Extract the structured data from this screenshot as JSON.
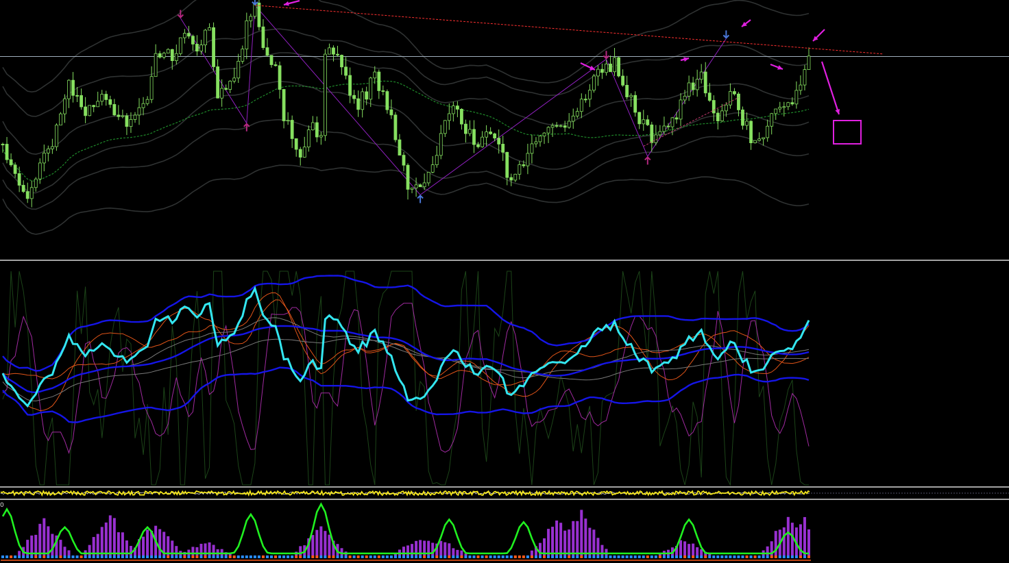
{
  "window": {
    "background": "#000000",
    "separator_color": "#d9d9d9"
  },
  "chart_data": [
    {
      "type": "candlestick",
      "panel": "price",
      "title": "",
      "grid": false,
      "bar_count": 196,
      "axes": {
        "x_ticks": [],
        "y_ticks": []
      },
      "close_path": [
        [
          0,
          0.55
        ],
        [
          6,
          0.78
        ],
        [
          8,
          0.68
        ],
        [
          13,
          0.5
        ],
        [
          16,
          0.3
        ],
        [
          20,
          0.45
        ],
        [
          24,
          0.35
        ],
        [
          30,
          0.48
        ],
        [
          35,
          0.4
        ],
        [
          37,
          0.17
        ],
        [
          41,
          0.22
        ],
        [
          44,
          0.1
        ],
        [
          47,
          0.18
        ],
        [
          50,
          0.1
        ],
        [
          52,
          0.35
        ],
        [
          57,
          0.25
        ],
        [
          59,
          0.1
        ],
        [
          61,
          0.02
        ],
        [
          63,
          0.18
        ],
        [
          66,
          0.25
        ],
        [
          68,
          0.45
        ],
        [
          72,
          0.6
        ],
        [
          75,
          0.48
        ],
        [
          77,
          0.52
        ],
        [
          78,
          0.22
        ],
        [
          80,
          0.18
        ],
        [
          83,
          0.3
        ],
        [
          86,
          0.4
        ],
        [
          88,
          0.35
        ],
        [
          90,
          0.28
        ],
        [
          92,
          0.35
        ],
        [
          94,
          0.45
        ],
        [
          96,
          0.6
        ],
        [
          99,
          0.75
        ],
        [
          101,
          0.72
        ],
        [
          104,
          0.65
        ],
        [
          107,
          0.45
        ],
        [
          110,
          0.42
        ],
        [
          112,
          0.5
        ],
        [
          115,
          0.55
        ],
        [
          117,
          0.48
        ],
        [
          120,
          0.55
        ],
        [
          123,
          0.72
        ],
        [
          125,
          0.65
        ],
        [
          128,
          0.55
        ],
        [
          131,
          0.5
        ],
        [
          134,
          0.5
        ],
        [
          137,
          0.44
        ],
        [
          140,
          0.38
        ],
        [
          143,
          0.3
        ],
        [
          146,
          0.26
        ],
        [
          148,
          0.22
        ],
        [
          151,
          0.35
        ],
        [
          154,
          0.45
        ],
        [
          157,
          0.52
        ],
        [
          160,
          0.48
        ],
        [
          163,
          0.45
        ],
        [
          165,
          0.35
        ],
        [
          167,
          0.32
        ],
        [
          169,
          0.3
        ],
        [
          172,
          0.45
        ],
        [
          175,
          0.4
        ],
        [
          177,
          0.35
        ],
        [
          179,
          0.45
        ],
        [
          181,
          0.52
        ],
        [
          184,
          0.5
        ],
        [
          186,
          0.45
        ],
        [
          189,
          0.38
        ],
        [
          191,
          0.4
        ],
        [
          193,
          0.3
        ],
        [
          195,
          0.2
        ]
      ],
      "moving_average": {
        "style": "dashed",
        "color": "#1f8a2a"
      },
      "envelope_band_count": 6,
      "trendlines": [
        {
          "from": [
            61,
            0.01
          ],
          "to": [
            213,
            0.2
          ],
          "style": "dashed",
          "color": "#ff3030"
        },
        {
          "from": [
            155,
            0.56
          ],
          "to": [
            178,
            0.37
          ],
          "style": "dashed",
          "color": "#c23a6e"
        }
      ],
      "horizontal_level": {
        "value": 0.21,
        "color": "#b8c8d8"
      },
      "zigzag_color": "#9020c0",
      "swing_markers": [
        {
          "bar": 43,
          "value": 0.06,
          "kind": "high",
          "color": "#b42880"
        },
        {
          "bar": 59,
          "value": 0.47,
          "kind": "low",
          "color": "#b42880"
        },
        {
          "bar": 61,
          "value": 0.01,
          "kind": "high",
          "color": "#4a78d8"
        },
        {
          "bar": 101,
          "value": 0.75,
          "kind": "low",
          "color": "#4a78d8"
        },
        {
          "bar": 146,
          "value": 0.22,
          "kind": "high",
          "color": "#b42880"
        },
        {
          "bar": 156,
          "value": 0.6,
          "kind": "low",
          "color": "#b42880"
        },
        {
          "bar": 175,
          "value": 0.14,
          "kind": "high",
          "color": "#4a78d8"
        }
      ],
      "annotations": {
        "color": "#e020e0",
        "arrows": 7,
        "forecast_box": true
      },
      "colors": {
        "candle": "#86e060",
        "band": "#2f3232"
      }
    },
    {
      "type": "line",
      "panel": "oscillator",
      "title": "",
      "grid": false,
      "axes": {
        "x_ticks": [],
        "y_ticks": []
      },
      "series": [
        {
          "role": "main",
          "color": "#33e6f0",
          "width": 3
        },
        {
          "role": "band-upper",
          "color": "#1515e8",
          "width": 2.4
        },
        {
          "role": "band-middle",
          "color": "#1515e8",
          "width": 2.4
        },
        {
          "role": "band-lower",
          "color": "#1515e8",
          "width": 2.4
        },
        {
          "role": "fast-oscillator",
          "color": "#1c4418"
        },
        {
          "role": "signal",
          "color": "#a02aa0"
        },
        {
          "role": "slow-signal",
          "color": "#e05418"
        },
        {
          "role": "average",
          "color": "#7a7a7a"
        }
      ]
    },
    {
      "type": "line",
      "panel": "strip",
      "title": "",
      "grid": false,
      "series": [
        {
          "role": "main",
          "color": "#f2e41a"
        },
        {
          "role": "secondary",
          "color": "#e0e0e0"
        }
      ]
    },
    {
      "type": "bar",
      "panel": "histogram",
      "title": "",
      "grid": false,
      "axes": {
        "y_ticks": [
          "0"
        ]
      },
      "bar_peaks": [
        {
          "bar": 10,
          "height": 0.75
        },
        {
          "bar": 26,
          "height": 0.9
        },
        {
          "bar": 37,
          "height": 0.75
        },
        {
          "bar": 49,
          "height": 0.3
        },
        {
          "bar": 77,
          "height": 0.65
        },
        {
          "bar": 101,
          "height": 0.4
        },
        {
          "bar": 106,
          "height": 0.35
        },
        {
          "bar": 134,
          "height": 0.75
        },
        {
          "bar": 140,
          "height": 0.95
        },
        {
          "bar": 165,
          "height": 0.35
        },
        {
          "bar": 190,
          "height": 0.85
        },
        {
          "bar": 194,
          "height": 0.8
        }
      ],
      "line_peaks": [
        {
          "bar": 1,
          "height": 0.9
        },
        {
          "bar": 15,
          "height": 0.55
        },
        {
          "bar": 35,
          "height": 0.55
        },
        {
          "bar": 60,
          "height": 0.8
        },
        {
          "bar": 77,
          "height": 1.0
        },
        {
          "bar": 108,
          "height": 0.7
        },
        {
          "bar": 126,
          "height": 0.65
        },
        {
          "bar": 166,
          "height": 0.7
        },
        {
          "bar": 190,
          "height": 0.45
        }
      ],
      "colors": {
        "histogram": "#9830d0",
        "line": "#20f020",
        "baseline_positive": "#2a8cff",
        "baseline_negative": "#ff5a1a"
      }
    }
  ],
  "labels": {
    "histogram_zero": "0"
  }
}
